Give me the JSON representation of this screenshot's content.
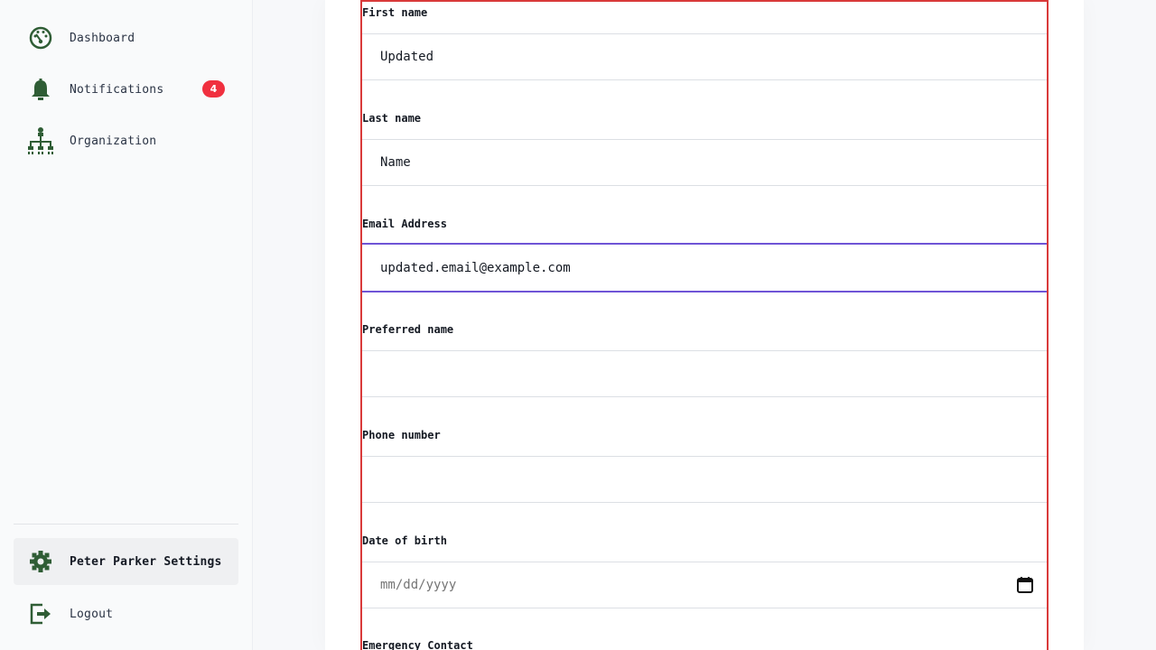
{
  "sidebar": {
    "nav": [
      {
        "label": "Dashboard",
        "icon": "dashboard-icon"
      },
      {
        "label": "Notifications",
        "icon": "bell-icon",
        "badge": "4"
      },
      {
        "label": "Organization",
        "icon": "org-chart-icon"
      }
    ],
    "bottom": [
      {
        "label": "Peter Parker Settings",
        "icon": "gear-icon"
      },
      {
        "label": "Logout",
        "icon": "logout-icon"
      }
    ]
  },
  "form": {
    "first_name": {
      "label": "First name",
      "value": "Updated"
    },
    "last_name": {
      "label": "Last name",
      "value": "Name"
    },
    "email": {
      "label": "Email Address",
      "value": "updated.email@example.com"
    },
    "preferred_name": {
      "label": "Preferred name",
      "value": ""
    },
    "phone": {
      "label": "Phone number",
      "value": ""
    },
    "dob": {
      "label": "Date of birth",
      "placeholder": "mm/dd/yyyy"
    },
    "emergency": {
      "label": "Emergency Contact"
    }
  },
  "colors": {
    "icon_green": "#2f5d35",
    "badge_red": "#f0303f",
    "focus_purple": "#6f54d6",
    "outline_red": "#d93a3a"
  }
}
